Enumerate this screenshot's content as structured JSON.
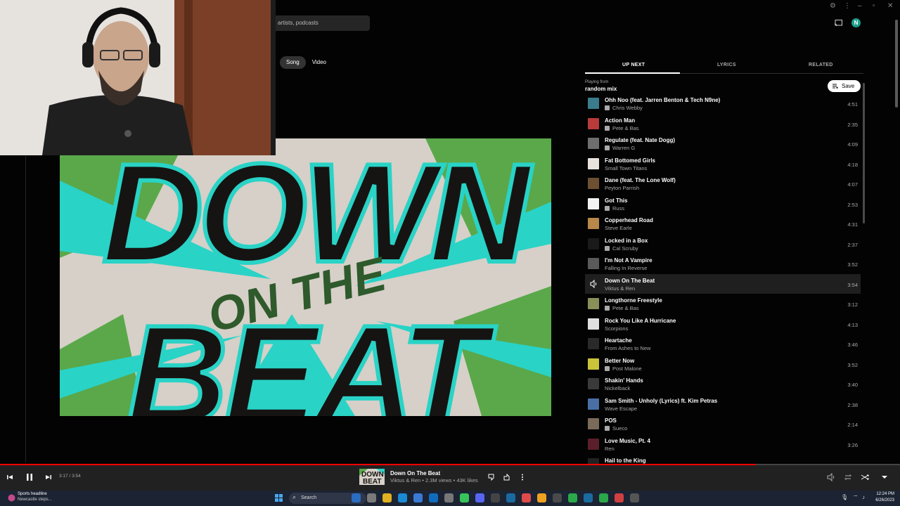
{
  "header": {
    "search_placeholder": "artists, podcasts",
    "avatar_letter": "N"
  },
  "toggle": {
    "song": "Song",
    "video": "Video"
  },
  "panel": {
    "tabs": [
      "UP NEXT",
      "LYRICS",
      "RELATED"
    ],
    "playing_from_label": "Playing from",
    "mix_name": "random mix",
    "save_label": "Save"
  },
  "queue": [
    {
      "title": "Ohh Noo (feat. Jarren Benton & Tech N9ne)",
      "artist": "Chris Webby",
      "duration": "4:51",
      "explicit": true,
      "thumb_color": "#3a7c8c"
    },
    {
      "title": "Action Man",
      "artist": "Pete & Bas",
      "duration": "2:35",
      "explicit": true,
      "thumb_color": "#b83a3a"
    },
    {
      "title": "Regulate (feat. Nate Dogg)",
      "artist": "Warren G",
      "duration": "4:09",
      "explicit": true,
      "thumb_color": "#6e6e6e"
    },
    {
      "title": "Fat Bottomed Girls",
      "artist": "Small Town Titans",
      "duration": "4:18",
      "explicit": false,
      "thumb_color": "#e8e2dc"
    },
    {
      "title": "Dane (feat. The Lone Wolf)",
      "artist": "Peyton Parrish",
      "duration": "4:07",
      "explicit": false,
      "thumb_color": "#6d4f32"
    },
    {
      "title": "Got This",
      "artist": "Russ",
      "duration": "2:53",
      "explicit": true,
      "thumb_color": "#f2f2f2"
    },
    {
      "title": "Copperhead Road",
      "artist": "Steve Earle",
      "duration": "4:31",
      "explicit": false,
      "thumb_color": "#b8874a"
    },
    {
      "title": "Locked in a Box",
      "artist": "Cal Scruby",
      "duration": "2:37",
      "explicit": true,
      "thumb_color": "#1a1a1a"
    },
    {
      "title": "I'm Not A Vampire",
      "artist": "Falling In Reverse",
      "duration": "3:52",
      "explicit": false,
      "thumb_color": "#5a5a5a"
    },
    {
      "title": "Down On The Beat",
      "artist": "Viktus & Ren",
      "duration": "3:54",
      "explicit": false,
      "thumb_color": "#1f1f1f",
      "current": true
    },
    {
      "title": "Longthorne Freestyle",
      "artist": "Pete & Bas",
      "duration": "3:12",
      "explicit": true,
      "thumb_color": "#8a8f5a"
    },
    {
      "title": "Rock You Like A Hurricane",
      "artist": "Scorpions",
      "duration": "4:13",
      "explicit": false,
      "thumb_color": "#e0e0e0"
    },
    {
      "title": "Heartache",
      "artist": "From Ashes to New",
      "duration": "3:46",
      "explicit": false,
      "thumb_color": "#2a2a2a"
    },
    {
      "title": "Better Now",
      "artist": "Post Malone",
      "duration": "3:52",
      "explicit": true,
      "thumb_color": "#c9c43a"
    },
    {
      "title": "Shakin' Hands",
      "artist": "Nickelback",
      "duration": "3:40",
      "explicit": false,
      "thumb_color": "#3a3a3a"
    },
    {
      "title": "Sam Smith - Unholy (Lyrics) ft. Kim Petras",
      "artist": "Wave Escape",
      "duration": "2:38",
      "explicit": false,
      "thumb_color": "#4a6fa5"
    },
    {
      "title": "POS",
      "artist": "Sueco",
      "duration": "2:14",
      "explicit": true,
      "thumb_color": "#7a6a5a"
    },
    {
      "title": "Love Music, Pt. 4",
      "artist": "Ren",
      "duration": "3:26",
      "explicit": false,
      "thumb_color": "#5a1f2a"
    },
    {
      "title": "Hail to the King",
      "artist": "",
      "duration": "",
      "explicit": false,
      "thumb_color": "#222"
    }
  ],
  "player": {
    "time": "3:17 / 3:54",
    "progress": 0.84,
    "now_title": "Down On The Beat",
    "now_meta": "Viktus & Ren • 2.3M views • 43K likes"
  },
  "taskbar": {
    "news_title": "Sports headline",
    "news_sub": "Newcastle steps...",
    "search_label": "Search",
    "time": "12:24 PM",
    "date": "6/26/2023"
  },
  "colors": {
    "accent": "#ff0000",
    "art_teal": "#29d3c6",
    "art_green": "#5aa84a",
    "art_dark": "#151412"
  }
}
